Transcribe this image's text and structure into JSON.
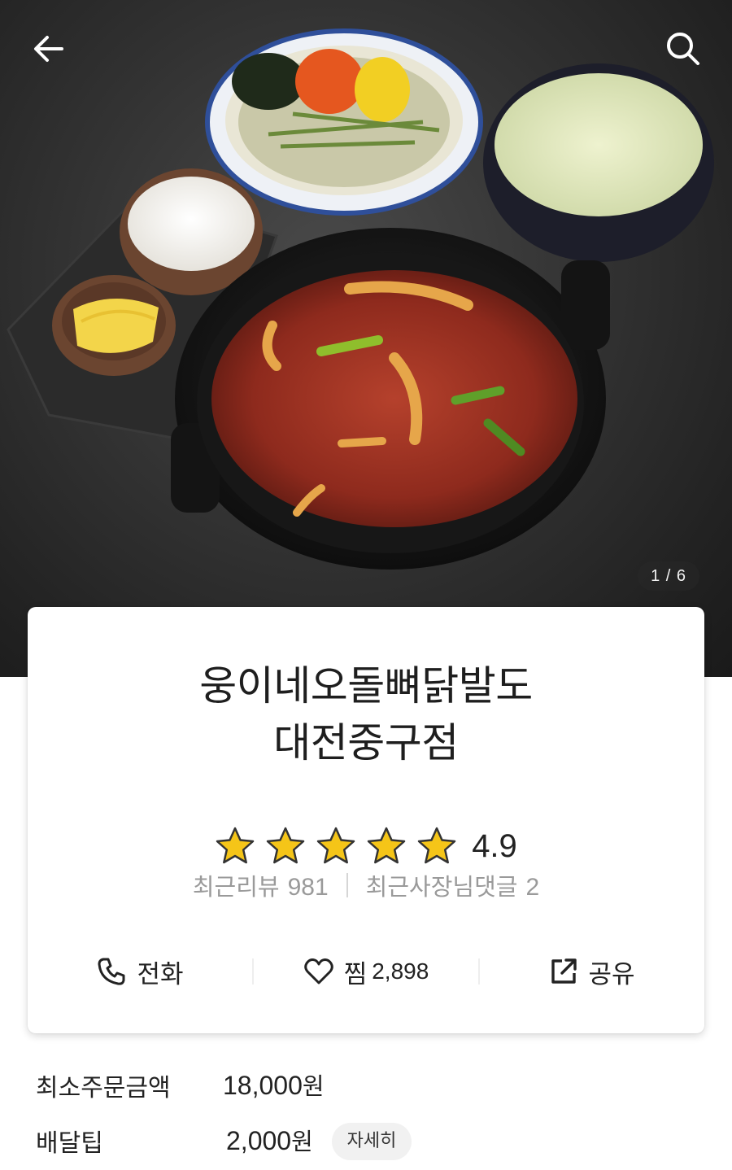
{
  "header": {
    "back_icon": "back-arrow-icon",
    "search_icon": "search-icon",
    "photo_counter": "1 / 6"
  },
  "store": {
    "name_line1": "웅이네오돌뼈닭발도",
    "name_line2": "대전중구점",
    "rating": "4.9",
    "stars_filled": 5,
    "star_color": "#F5C518",
    "recent_reviews_label": "최근리뷰",
    "recent_reviews_count": "981",
    "owner_replies_label": "최근사장님댓글",
    "owner_replies_count": "2"
  },
  "actions": {
    "call_label": "전화",
    "like_label": "찜",
    "like_count": "2,898",
    "share_label": "공유"
  },
  "delivery": {
    "min_order_label": "최소주문금액",
    "min_order_amount": "18,000",
    "min_order_unit": "원",
    "tip_label": "배달팁",
    "tip_amount": "2,000",
    "tip_unit": "원",
    "detail_button": "자세히"
  }
}
